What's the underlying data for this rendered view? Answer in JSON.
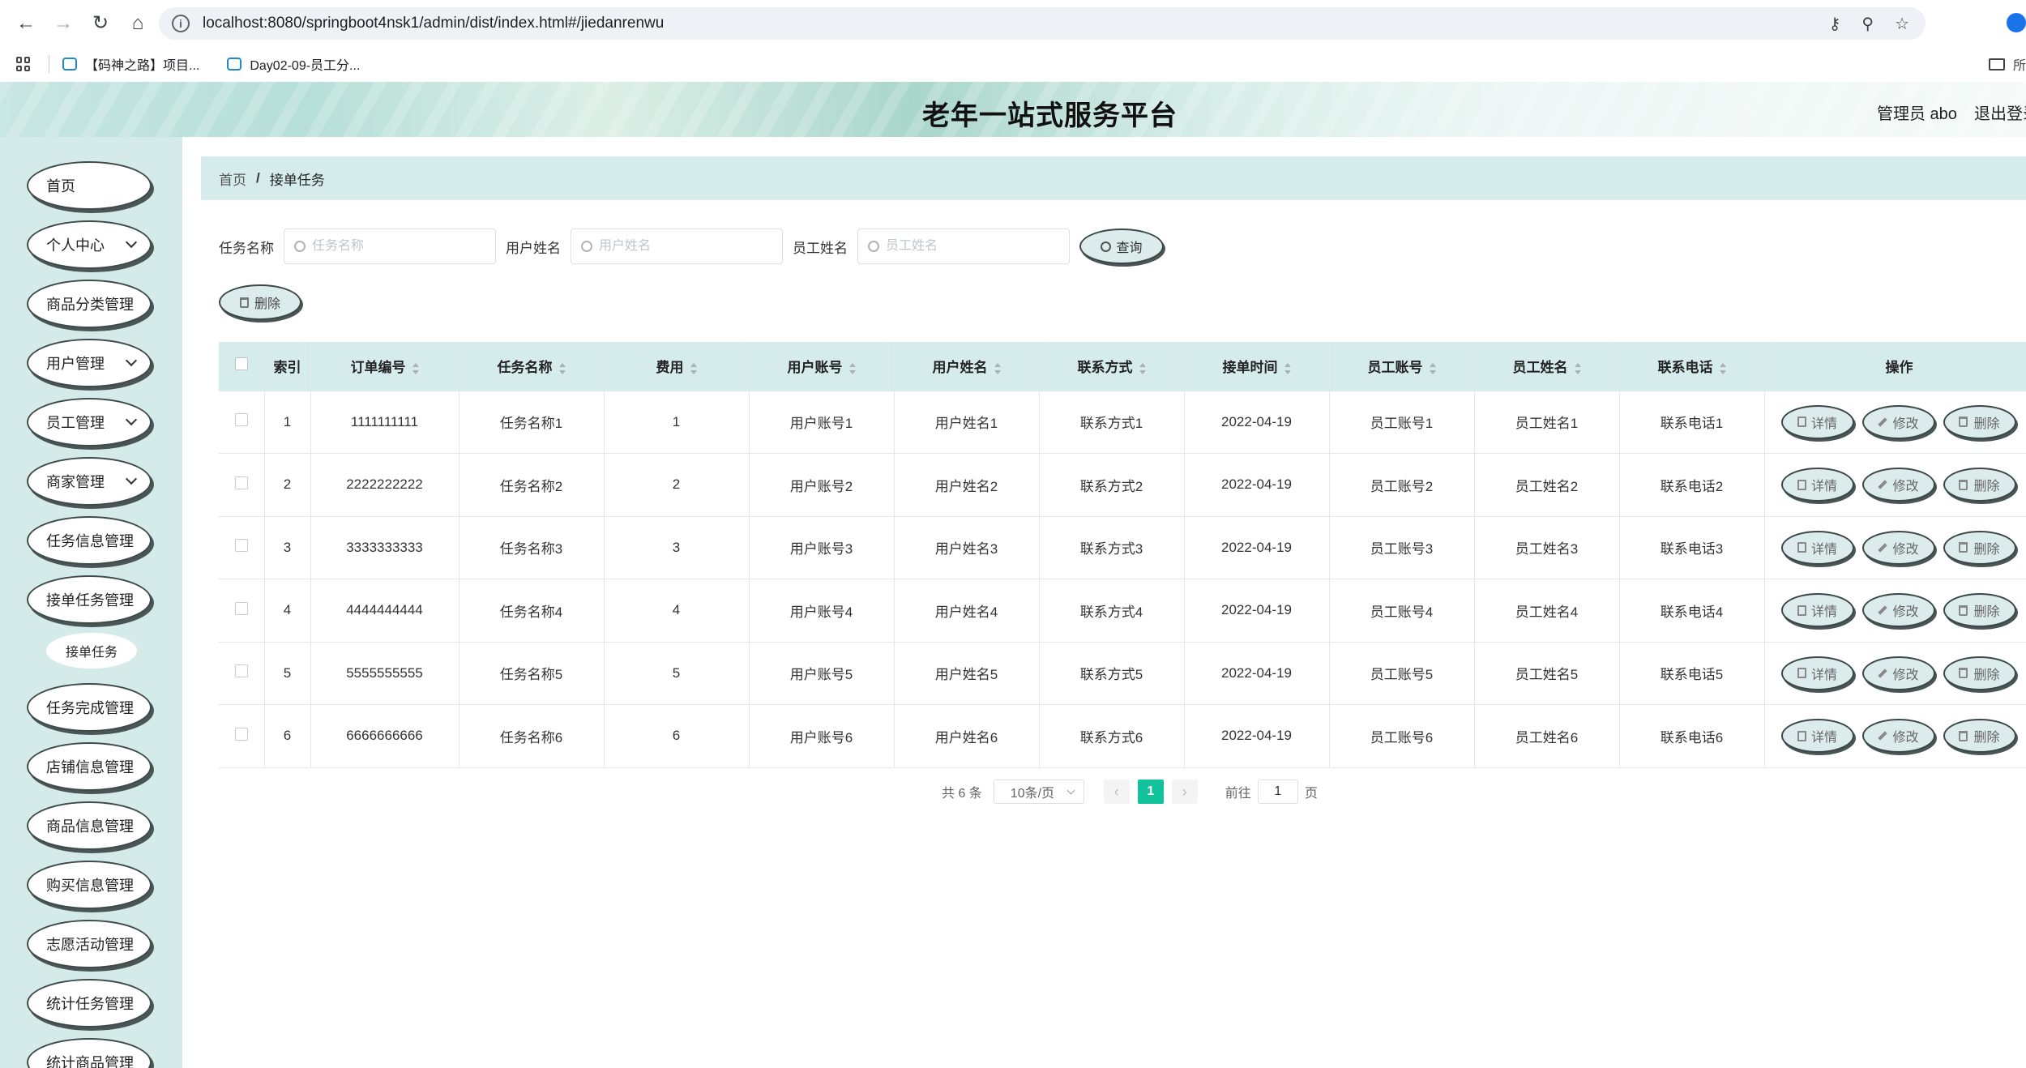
{
  "browser": {
    "url": "localhost:8080/springboot4nsk1/admin/dist/index.html#/jiedanrenwu",
    "bookmarks": [
      {
        "label": "【码神之路】项目..."
      },
      {
        "label": "Day02-09-员工分..."
      }
    ],
    "bookmarks_right": "所"
  },
  "header": {
    "title": "老年一站式服务平台",
    "user": "管理员 abo",
    "logout": "退出登录"
  },
  "sidebar": {
    "items": [
      {
        "label": "首页",
        "has_arrow": false
      },
      {
        "label": "个人中心",
        "has_arrow": true
      },
      {
        "label": "商品分类管理",
        "has_arrow": false
      },
      {
        "label": "用户管理",
        "has_arrow": true
      },
      {
        "label": "员工管理",
        "has_arrow": true
      },
      {
        "label": "商家管理",
        "has_arrow": true
      },
      {
        "label": "任务信息管理",
        "has_arrow": false
      },
      {
        "label": "接单任务管理",
        "has_arrow": false
      },
      {
        "label": "任务完成管理",
        "has_arrow": false
      },
      {
        "label": "店铺信息管理",
        "has_arrow": false
      },
      {
        "label": "商品信息管理",
        "has_arrow": false
      },
      {
        "label": "购买信息管理",
        "has_arrow": false
      },
      {
        "label": "志愿活动管理",
        "has_arrow": false
      },
      {
        "label": "统计任务管理",
        "has_arrow": false
      },
      {
        "label": "统计商品管理",
        "has_arrow": false
      }
    ],
    "submenu": {
      "label": "接单任务"
    }
  },
  "breadcrumb": {
    "home": "首页",
    "separator": "/",
    "current": "接单任务"
  },
  "search": {
    "task_label": "任务名称",
    "task_placeholder": "任务名称",
    "user_label": "用户姓名",
    "user_placeholder": "用户姓名",
    "staff_label": "员工姓名",
    "staff_placeholder": "员工姓名",
    "query_button": "查询"
  },
  "toolbar": {
    "delete_button": "删除"
  },
  "table": {
    "headers": [
      "索引",
      "订单编号",
      "任务名称",
      "费用",
      "用户账号",
      "用户姓名",
      "联系方式",
      "接单时间",
      "员工账号",
      "员工姓名",
      "联系电话",
      "操作"
    ],
    "rows": [
      {
        "index": "1",
        "order": "1111111111",
        "task": "任务名称1",
        "fee": "1",
        "account": "用户账号1",
        "name": "用户姓名1",
        "contact": "联系方式1",
        "time": "2022-04-19",
        "staff_acc": "员工账号1",
        "staff_name": "员工姓名1",
        "phone": "联系电话1"
      },
      {
        "index": "2",
        "order": "2222222222",
        "task": "任务名称2",
        "fee": "2",
        "account": "用户账号2",
        "name": "用户姓名2",
        "contact": "联系方式2",
        "time": "2022-04-19",
        "staff_acc": "员工账号2",
        "staff_name": "员工姓名2",
        "phone": "联系电话2"
      },
      {
        "index": "3",
        "order": "3333333333",
        "task": "任务名称3",
        "fee": "3",
        "account": "用户账号3",
        "name": "用户姓名3",
        "contact": "联系方式3",
        "time": "2022-04-19",
        "staff_acc": "员工账号3",
        "staff_name": "员工姓名3",
        "phone": "联系电话3"
      },
      {
        "index": "4",
        "order": "4444444444",
        "task": "任务名称4",
        "fee": "4",
        "account": "用户账号4",
        "name": "用户姓名4",
        "contact": "联系方式4",
        "time": "2022-04-19",
        "staff_acc": "员工账号4",
        "staff_name": "员工姓名4",
        "phone": "联系电话4"
      },
      {
        "index": "5",
        "order": "5555555555",
        "task": "任务名称5",
        "fee": "5",
        "account": "用户账号5",
        "name": "用户姓名5",
        "contact": "联系方式5",
        "time": "2022-04-19",
        "staff_acc": "员工账号5",
        "staff_name": "员工姓名5",
        "phone": "联系电话5"
      },
      {
        "index": "6",
        "order": "6666666666",
        "task": "任务名称6",
        "fee": "6",
        "account": "用户账号6",
        "name": "用户姓名6",
        "contact": "联系方式6",
        "time": "2022-04-19",
        "staff_acc": "员工账号6",
        "staff_name": "员工姓名6",
        "phone": "联系电话6"
      }
    ],
    "actions": {
      "detail": "详情",
      "edit": "修改",
      "delete": "删除"
    }
  },
  "pagination": {
    "total": "共 6 条",
    "page_size": "10条/页",
    "current_page": "1",
    "goto_prefix": "前往",
    "goto_value": "1",
    "goto_suffix": "页"
  },
  "colors": {
    "accent": "#12c29a",
    "sidebar_bg": "#d4ebea",
    "header_row_bg": "#d6ecec"
  }
}
